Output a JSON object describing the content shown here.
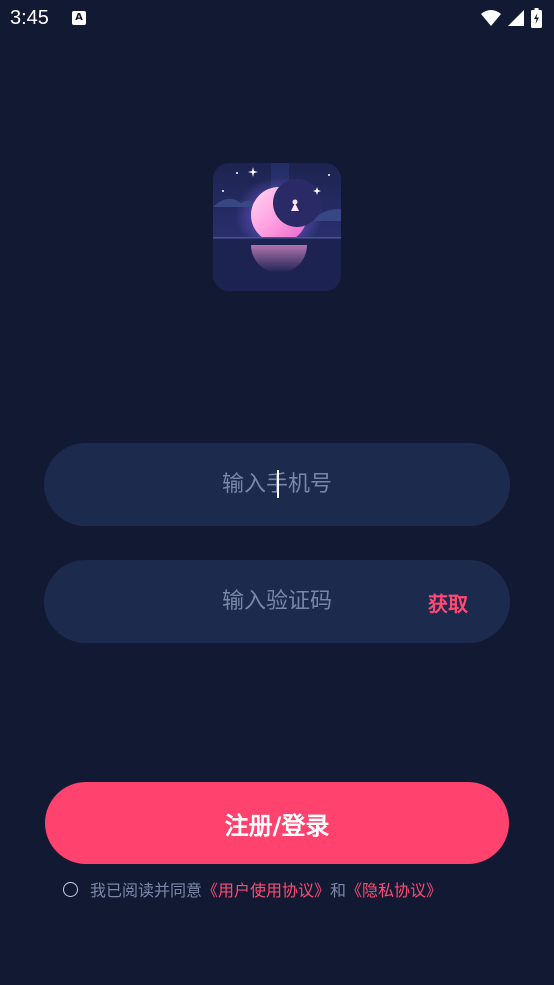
{
  "status_bar": {
    "time": "3:45",
    "notification_icon": "A"
  },
  "login": {
    "phone_placeholder": "输入手机号",
    "code_placeholder": "输入验证码",
    "get_code_label": "获取",
    "submit_label": "注册/登录"
  },
  "agreement": {
    "prefix": "我已阅读并同意",
    "user_agreement": "《用户使用协议》",
    "conjunction": "和",
    "privacy_policy": "《隐私协议》"
  },
  "colors": {
    "background": "#121a33",
    "field": "#1c2a4d",
    "accent": "#ff426e"
  }
}
